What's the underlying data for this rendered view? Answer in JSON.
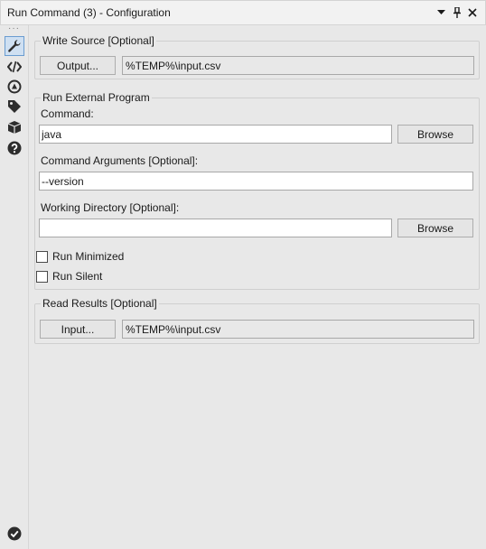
{
  "window": {
    "title": "Run Command (3) - Configuration",
    "controls": [
      "dropdown-icon",
      "pin-icon",
      "close-icon"
    ]
  },
  "sidebar": {
    "items": [
      {
        "name": "wrench-icon",
        "active": true
      },
      {
        "name": "code-icon",
        "active": false
      },
      {
        "name": "connection-icon",
        "active": false
      },
      {
        "name": "tag-icon",
        "active": false
      },
      {
        "name": "box-icon",
        "active": false
      },
      {
        "name": "help-icon",
        "active": false
      }
    ],
    "bottom_icon": "check-icon"
  },
  "write_source": {
    "legend": "Write Source [Optional]",
    "button_label": "Output...",
    "path": "%TEMP%\\input.csv"
  },
  "external_program": {
    "legend": "Run External Program",
    "command_label": "Command:",
    "command_value": "java",
    "browse_label": "Browse",
    "args_label": "Command Arguments [Optional]:",
    "args_value": "--version",
    "workdir_label": "Working Directory [Optional]:",
    "workdir_value": "",
    "browse2_label": "Browse",
    "run_minimized_label": "Run Minimized",
    "run_minimized_checked": false,
    "run_silent_label": "Run Silent",
    "run_silent_checked": false
  },
  "read_results": {
    "legend": "Read Results [Optional]",
    "button_label": "Input...",
    "path": "%TEMP%\\input.csv"
  },
  "colors": {
    "accent": "#3b6fb6",
    "panel": "#e8e8e8"
  }
}
